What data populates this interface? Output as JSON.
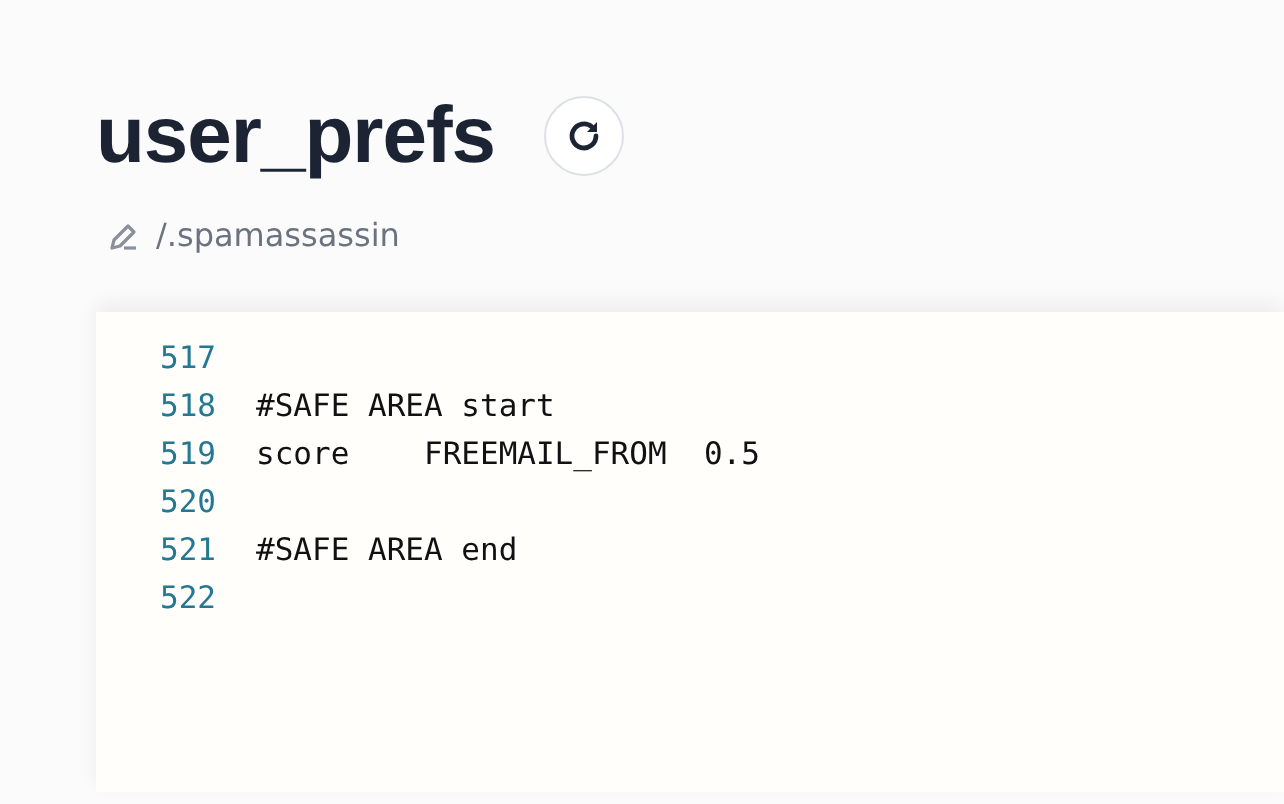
{
  "page": {
    "title": "user_prefs",
    "path": "/.spamassassin"
  },
  "editor": {
    "lines": [
      {
        "number": "517"
      },
      {
        "number": "518",
        "code": "#SAFE AREA start"
      },
      {
        "number": "519",
        "code": "score    FREEMAIL_FROM  0.5"
      },
      {
        "number": "520"
      },
      {
        "number": "521",
        "code": "#SAFE AREA end"
      },
      {
        "number": "522"
      }
    ]
  }
}
